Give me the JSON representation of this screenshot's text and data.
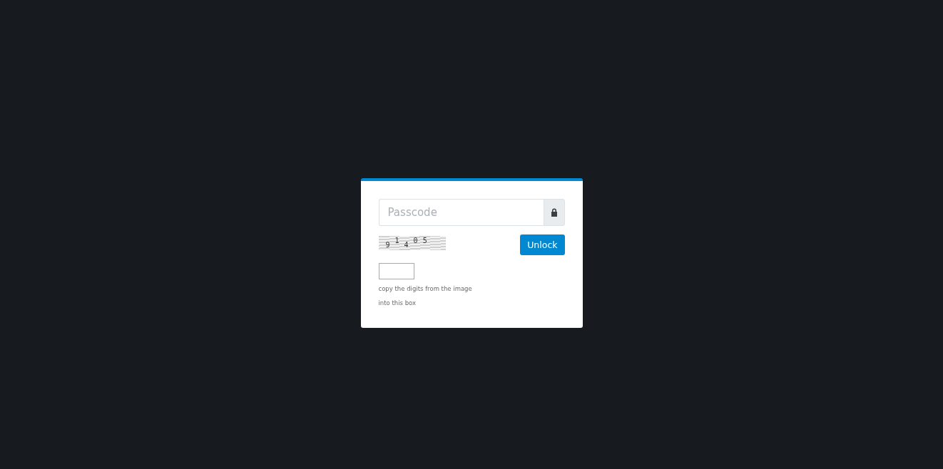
{
  "login": {
    "passcode": {
      "placeholder": "Passcode"
    },
    "captcha": {
      "digits": [
        "9",
        "1",
        "4",
        "0",
        "5"
      ]
    },
    "unlock_button": "Unlock",
    "hint_lines": [
      "copy the digits from the image",
      "into this box"
    ]
  }
}
